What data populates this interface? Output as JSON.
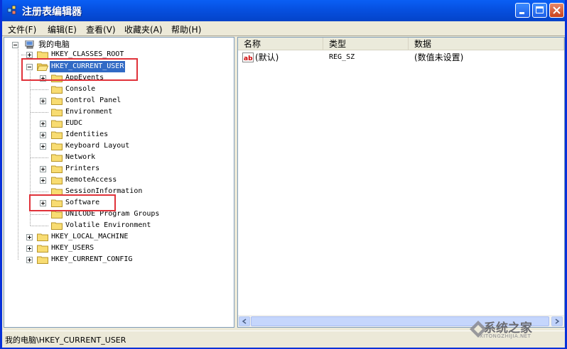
{
  "window": {
    "title": "注册表编辑器",
    "accent": "#0a5ff5"
  },
  "menubar": {
    "items": [
      "文件(F)",
      "编辑(E)",
      "查看(V)",
      "收藏夹(A)",
      "帮助(H)"
    ]
  },
  "tree": {
    "root": "我的电脑",
    "hives": {
      "classes_root": "HKEY_CLASSES_ROOT",
      "current_user": "HKEY_CURRENT_USER",
      "local_machine": "HKEY_LOCAL_MACHINE",
      "users": "HKEY_USERS",
      "current_config": "HKEY_CURRENT_CONFIG"
    },
    "current_user_children": [
      "AppEvents",
      "Console",
      "Control Panel",
      "Environment",
      "EUDC",
      "Identities",
      "Keyboard Layout",
      "Network",
      "Printers",
      "RemoteAccess",
      "SessionInformation",
      "Software",
      "UNICODE Program Groups",
      "Volatile Environment"
    ]
  },
  "list": {
    "columns": [
      "名称",
      "类型",
      "数据"
    ],
    "rows": [
      {
        "name": "(默认)",
        "type": "REG_SZ",
        "data": "(数值未设置)",
        "icon": "ab-string-icon"
      }
    ]
  },
  "statusbar": {
    "path": "我的电脑\\HKEY_CURRENT_USER"
  },
  "watermark": {
    "text": "系统之家",
    "sub": "XITONGZHIJIA.NET"
  },
  "highlight_color": "#e0323a"
}
